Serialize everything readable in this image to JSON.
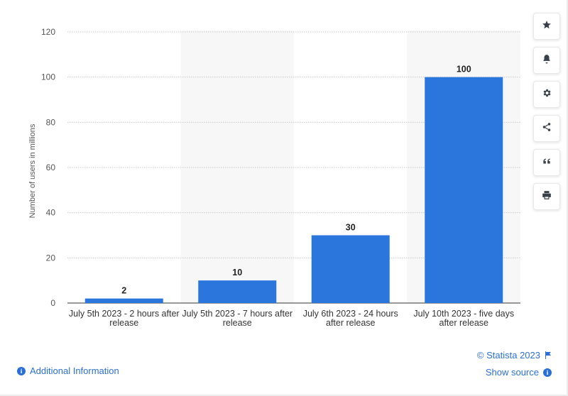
{
  "chart_data": {
    "type": "bar",
    "categories": [
      [
        "July 5th 2023 - 2 hours after",
        "release"
      ],
      [
        "July 5th 2023 - 7 hours after",
        "release"
      ],
      [
        "July 6th 2023 - 24 hours",
        "after release"
      ],
      [
        "July 10th 2023 - five days",
        "after release"
      ]
    ],
    "values": [
      2,
      10,
      30,
      100
    ],
    "data_labels": [
      "2",
      "10",
      "30",
      "100"
    ],
    "ylabel": "Number of users in millions",
    "ylim": [
      0,
      120
    ],
    "yticks": [
      0,
      20,
      40,
      60,
      80,
      100,
      120
    ],
    "grid": true,
    "bar_color": "#2a76dc",
    "alt_band_color": "#f7f7f8"
  },
  "toolbar": {
    "buttons": [
      {
        "name": "star-icon"
      },
      {
        "name": "bell-icon"
      },
      {
        "name": "gear-icon"
      },
      {
        "name": "share-icon"
      },
      {
        "name": "quote-icon"
      },
      {
        "name": "print-icon"
      }
    ]
  },
  "footer": {
    "copyright": "© Statista 2023",
    "additional_info": "Additional Information",
    "show_source": "Show source"
  },
  "colors": {
    "link": "#2a6fd6"
  }
}
